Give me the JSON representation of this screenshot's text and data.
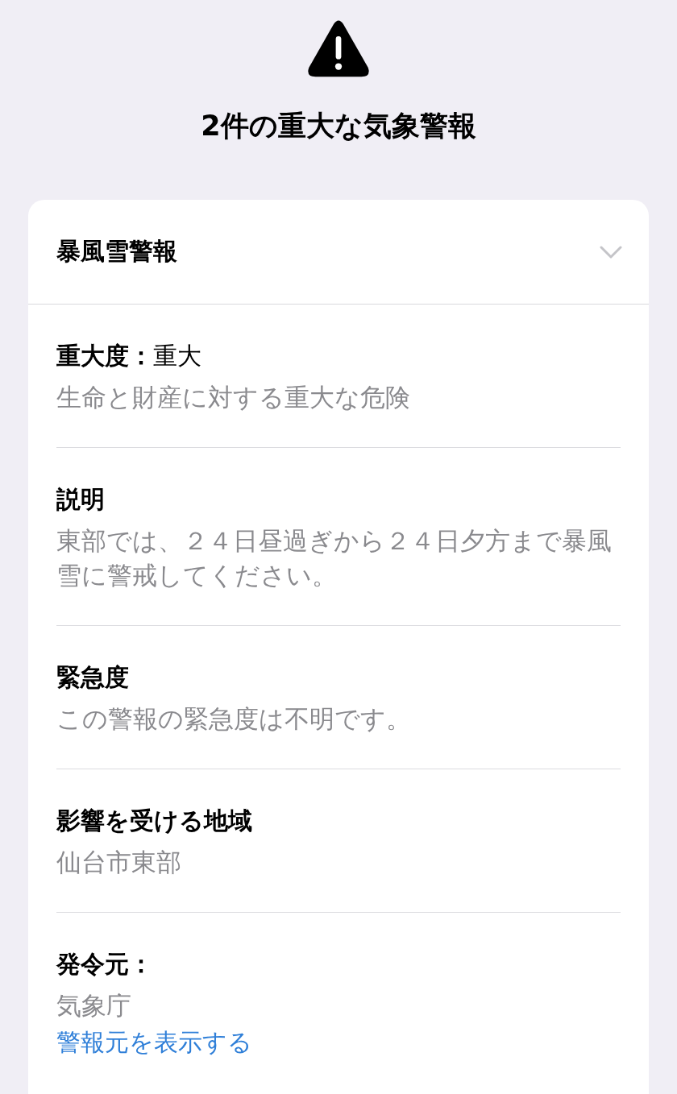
{
  "title": "2件の重大な気象警報",
  "alert": {
    "title": "暴風雪警報",
    "expanded": false,
    "sections": [
      {
        "label": "重大度：",
        "value": "重大",
        "description": "生命と財産に対する重大な危険"
      },
      {
        "label": "説明",
        "description": "東部では、２４日昼過ぎから２４日夕方まで暴風雪に警戒してください。"
      },
      {
        "label": "緊急度",
        "description": "この警報の緊急度は不明です。"
      },
      {
        "label": "影響を受ける地域",
        "description": "仙台市東部"
      },
      {
        "label": "発令元：",
        "description": "気象庁",
        "link": "警報元を表示する"
      }
    ]
  }
}
